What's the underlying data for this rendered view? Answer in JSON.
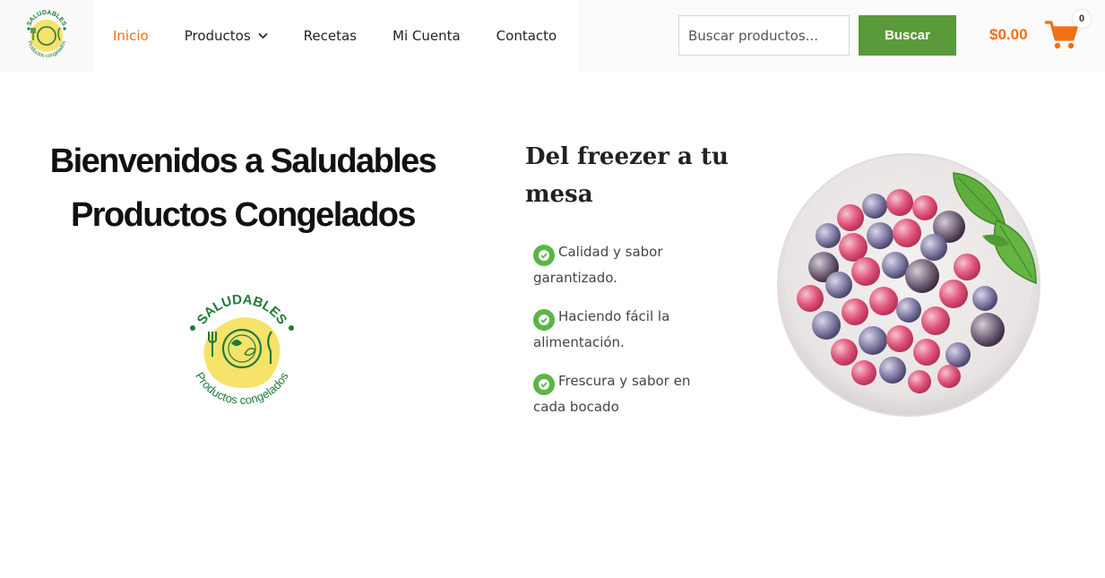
{
  "header": {
    "logo": {
      "top_text": "SALUDABLES",
      "bottom_text": "Productos congelados"
    },
    "nav": [
      {
        "label": "Inicio",
        "active": true
      },
      {
        "label": "Productos",
        "has_dropdown": true
      },
      {
        "label": "Recetas"
      },
      {
        "label": "Mi Cuenta"
      },
      {
        "label": "Contacto"
      }
    ],
    "search": {
      "placeholder": "Buscar productos...",
      "button_label": "Buscar"
    },
    "cart": {
      "total": "$0.00",
      "count": "0"
    }
  },
  "hero": {
    "title_line1": "Bienvenidos a Saludables",
    "title_line2": "Productos Congelados",
    "logo": {
      "top_text": "SALUDABLES",
      "bottom_text": "Productos congelados"
    },
    "subtitle_line1": "Del freezer a tu",
    "subtitle_line2": "mesa",
    "features": [
      {
        "line1": "Calidad y sabor",
        "line2": "garantizado."
      },
      {
        "line1": "Haciendo fácil la",
        "line2": "alimentación."
      },
      {
        "line1": "Frescura y sabor en",
        "line2": "cada bocado"
      }
    ]
  },
  "colors": {
    "accent_orange": "#f26f15",
    "brand_green": "#5a9a3a",
    "check_green": "#5cb546",
    "logo_yellow": "#f7e26a",
    "logo_dark_green": "#1f7a3a"
  },
  "icons": [
    "chevron-down-icon",
    "shopping-cart-icon",
    "check-circle-icon",
    "plate-fork-knife-icon"
  ]
}
